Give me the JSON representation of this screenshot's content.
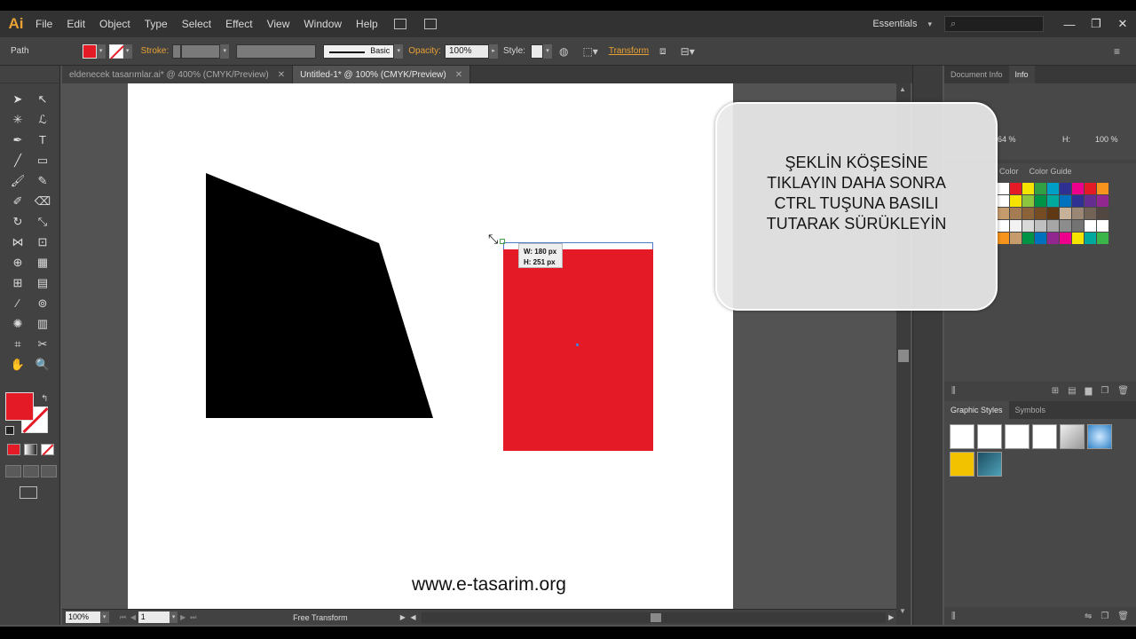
{
  "app": {
    "logo": "Ai"
  },
  "menu": [
    "File",
    "Edit",
    "Object",
    "Type",
    "Select",
    "Effect",
    "View",
    "Window",
    "Help"
  ],
  "workspace": {
    "label": "Essentials",
    "search_placeholder": ""
  },
  "window_controls": {
    "minimize": "—",
    "restore": "❐",
    "close": "✕"
  },
  "control": {
    "selection_type": "Path",
    "stroke_label": "Stroke:",
    "brush_label": "Basic",
    "opacity_label": "Opacity:",
    "opacity_value": "100%",
    "style_label": "Style:",
    "transform_label": "Transform",
    "fill_color": "#e41b26"
  },
  "tabs": [
    {
      "label": "eldenecek tasarımlar.ai* @ 400% (CMYK/Preview)",
      "close": "✕"
    },
    {
      "label": "Untitled-1* @ 100% (CMYK/Preview)",
      "close": "✕"
    }
  ],
  "canvas": {
    "tooltip_w": "W: 180 px",
    "tooltip_h": "H: 251 px",
    "rect_color": "#e41b26",
    "watermark": "www.e-tasarim.org"
  },
  "status": {
    "zoom": "100%",
    "page": "1",
    "tool_status": "Free Transform"
  },
  "panels": {
    "info_tabs": [
      "Document Info",
      "Info"
    ],
    "info_w": "64 %",
    "info_h_label": "H:",
    "info_h_value": "100 %",
    "color_tabs": [
      "Color",
      "Color Guide"
    ],
    "styles_tabs": [
      "Graphic Styles",
      "Symbols"
    ]
  },
  "swatches": [
    "#ffffff",
    "#e41b26",
    "#f5e400",
    "#31a045",
    "#00a0c6",
    "#2e3192",
    "#ec008c",
    "#e41b26",
    "#f7941d",
    "#ffffff",
    "#f5e400",
    "#8cc63f",
    "#009245",
    "#00a99d",
    "#0071bc",
    "#2e3192",
    "#662d91",
    "#92278f",
    "#c69c6d",
    "#a67c52",
    "#8c6239",
    "#754c24",
    "#603813",
    "#c7b299",
    "#998675",
    "#736357",
    "#534741",
    "#ffffff",
    "#f2f2f2",
    "#d9d9d9",
    "#bfbfbf",
    "#a6a6a6",
    "#8c8c8c",
    "#737373",
    "#ffffff",
    "#ffffff",
    "#f7941d",
    "#c69c6d",
    "#009245",
    "#0071bc",
    "#92278f",
    "#ec008c",
    "#f5e400",
    "#00a99d",
    "#39b54a"
  ],
  "instruction": {
    "line1": "ŞEKLİN KÖŞESİNE",
    "line2": "TIKLAYIN DAHA SONRA",
    "line3": "CTRL TUŞUNA BASILI",
    "line4": "TUTARAK SÜRÜKLEYİN"
  }
}
